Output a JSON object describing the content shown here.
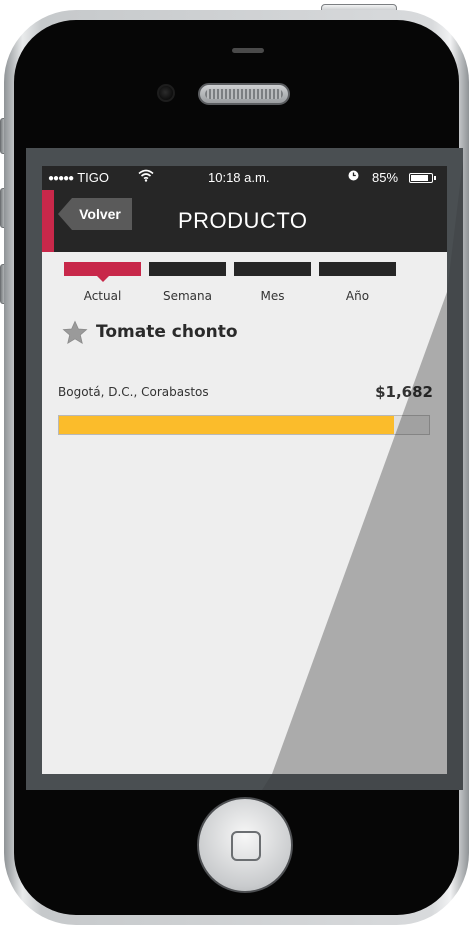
{
  "status_bar": {
    "carrier": "TIGO",
    "signal_icon": "signal-dots-icon",
    "wifi_icon": "wifi-icon",
    "time": "10:18 a.m.",
    "alarm_icon": "alarm-clock-icon",
    "battery_percent": "85%",
    "battery_level": 0.85
  },
  "navbar": {
    "back_label": "Volver",
    "title": "PRODUCTO"
  },
  "tabs": [
    {
      "label": "Actual",
      "active": true
    },
    {
      "label": "Semana",
      "active": false
    },
    {
      "label": "Mes",
      "active": false
    },
    {
      "label": "Año",
      "active": false
    }
  ],
  "product": {
    "favorite_icon": "star-icon",
    "name": "Tomate chonto"
  },
  "prices": [
    {
      "market": "Bogotá, D.C., Corabastos",
      "price": "$1,682",
      "level": 0.905
    }
  ],
  "colors": {
    "accent": "#c8284a",
    "bar_fill": "#fbbc2b",
    "header_bg": "#262626"
  }
}
